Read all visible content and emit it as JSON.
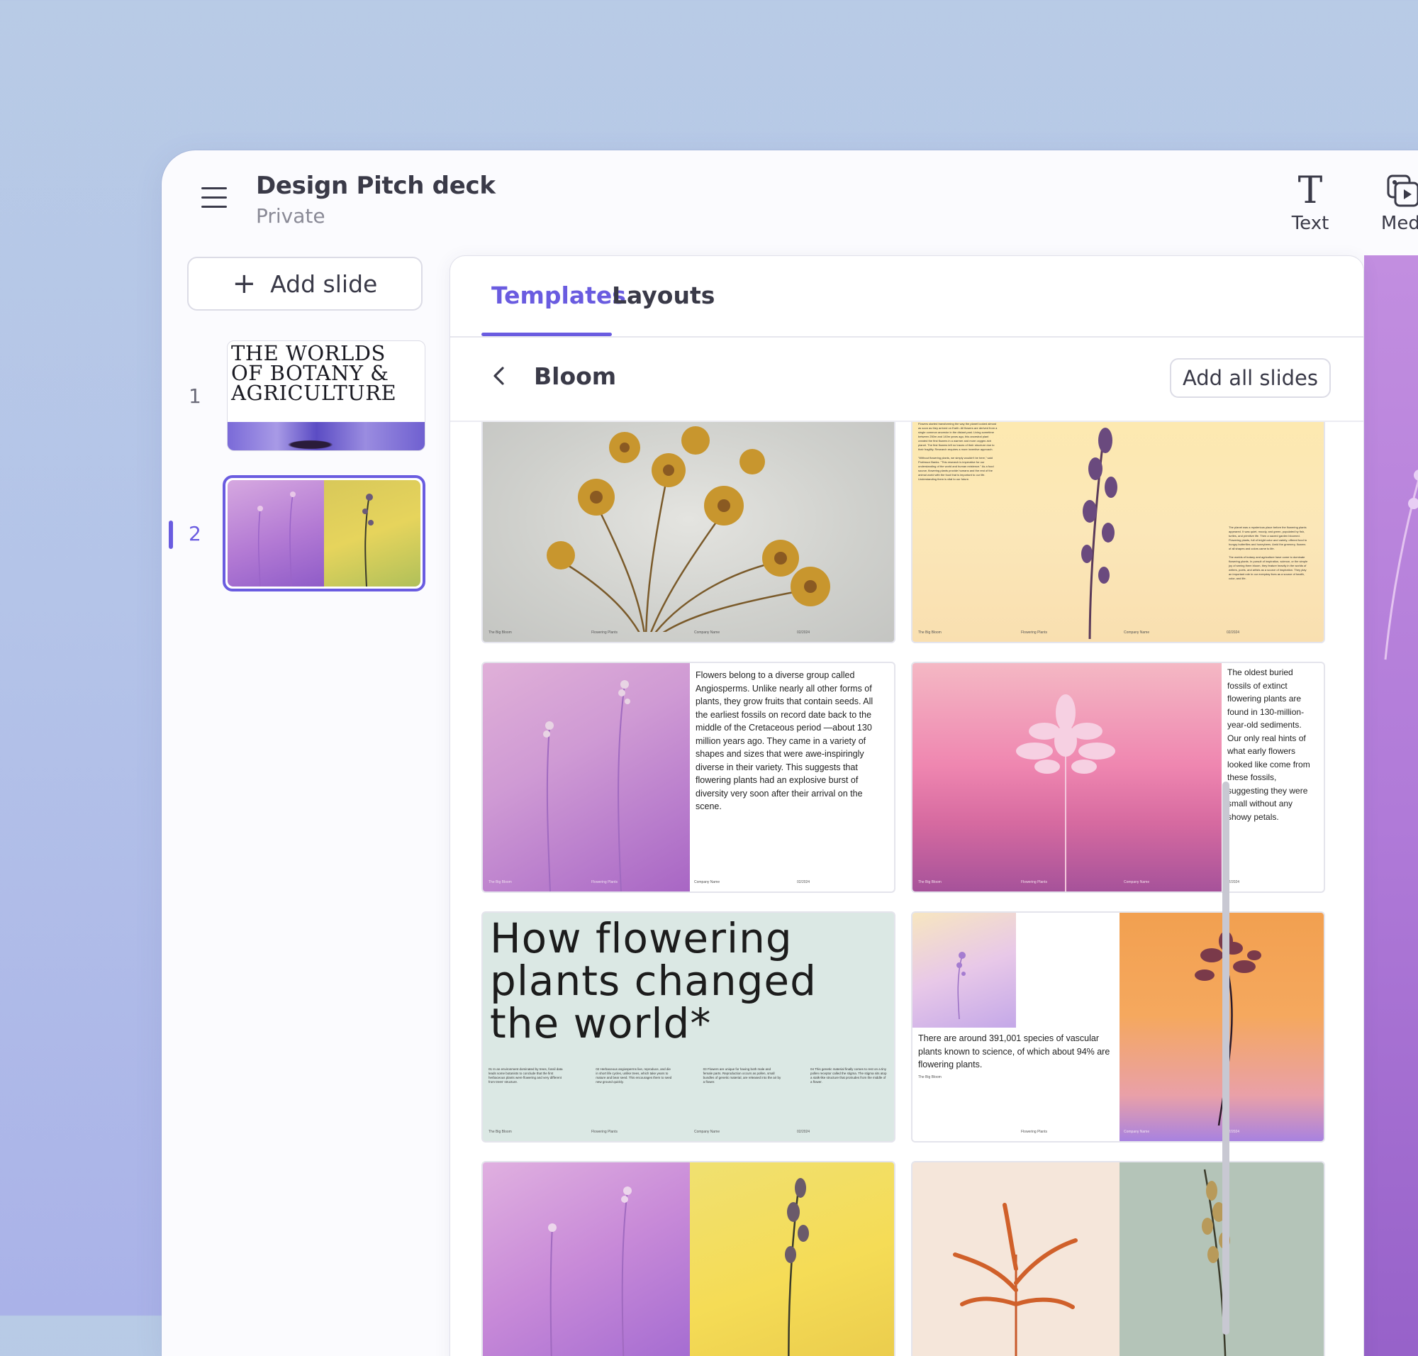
{
  "header": {
    "title": "Design Pitch deck",
    "subtitle": "Private"
  },
  "toolbar": {
    "text_label": "Text",
    "media_label": "Medi"
  },
  "sidebar": {
    "add_slide_label": "Add slide",
    "slides": [
      {
        "number": "1",
        "title": "THE WORLDS OF BOTANY & AGRICULTURE"
      },
      {
        "number": "2"
      }
    ]
  },
  "panel": {
    "tabs": [
      {
        "label": "Templates",
        "active": true
      },
      {
        "label": "Layouts",
        "active": false
      }
    ],
    "section_title": "Bloom",
    "add_all_label": "Add all slides"
  },
  "cards": {
    "c1": {
      "footer": [
        "The Big Bloom",
        "Flowering Plants",
        "Company Name",
        "02/2024"
      ]
    },
    "c2": {
      "text_left": "Flowers started transforming the way the planet looked almost as soon as they arrived on Earth. All flowers are derived from a single common ancestor in the distant past. Living sometime between 250m and 140m years ago, this ancestral plant created the first flowers in a warmer and more oxygen-rich planet. The first flowers left no traces of their structure due to their fragility. Research requires a more inventive approach.",
      "text_left_2": "\"Without flowering plants, we simply wouldn't be here,\" said Professor Banks. \"This research is imperative for our understanding of the world and human existence.\" As a food source, flowering plants provide humans and the rest of the animal world with the food that is important to our life. Understanding them is vital to our future.",
      "text_right": "The planet was a mysterious place before the flowering plants appeared. It was quiet, moody, and green, populated by fish, turtles, and primitive life. Then a sacred garden bloomed. Flowering plants, full of bright color and variety, offered food to hungry butterflies and honeybees. Amid the greenery, flowers of all shapes and colors came to life.",
      "text_right_2": "The worlds of botany and agriculture have come to dominate flowering plants. In pursuit of inspiration, science, or the simple joy of seeing them bloom, they feature heavily in the worlds of writers, poets, and artists as a source of inspiration. They play an important role in our everyday lives as a source of health, color, and life.",
      "footer": [
        "The Big Bloom",
        "Flowering Plants",
        "Company Name",
        "02/2024"
      ]
    },
    "c3": {
      "text": "Flowers belong to a diverse group called Angiosperms. Unlike nearly all other forms of plants, they grow fruits that contain seeds. All the earliest fossils on record date back to the middle of the Cretaceous period —about 130 million years ago. They came in a variety of shapes and sizes that were awe-inspiringly diverse in their variety. This suggests that flowering plants had an explosive burst of diversity very soon after their arrival on the scene.",
      "footer": [
        "The Big Bloom",
        "Flowering Plants",
        "Company Name",
        "02/2024"
      ]
    },
    "c4": {
      "text": "The oldest buried fossils of extinct flowering plants are found in 130-million-year-old sediments. Our only real hints of what early flowers looked like come from these fossils, suggesting they were small without any showy petals.",
      "footer": [
        "The Big Bloom",
        "Flowering Plants",
        "Company Name",
        "02/2024"
      ]
    },
    "c5": {
      "title": "How flowering plants changed the world*",
      "columns": [
        "01 In an environment dominated by trees, fossil data leads some botanists to conclude that the first herbaceous plants were flowering and very different from trees' structure.",
        "02 Herbaceous angiosperms live, reproduce, and die in short life cycles, unlike trees, which take years to mature and bear seed. This encourages them to seed new ground quickly.",
        "03 Flowers are unique for having both male and female parts. Reproduction occurs as pollen, small bundles of genetic material, are released into the air by a flower.",
        "04 This genetic material finally comes to rest on a tiny pollen receptor called the stigma. The stigma sits atop a stalk-like structure that protrudes from the middle of a flower."
      ],
      "footer": [
        "The Big Bloom",
        "Flowering Plants",
        "Company Name",
        "02/2024"
      ]
    },
    "c6": {
      "text": "There are around 391,001 species of vascular plants known to science, of which about 94% are flowering plants.",
      "caption": "The Big Bloom",
      "footer": [
        "Flowering Plants",
        "Company Name",
        "02/2024"
      ]
    }
  },
  "colors": {
    "accent": "#6a5ce0",
    "text_primary": "#3a3a48",
    "text_secondary": "#8a8a96"
  }
}
